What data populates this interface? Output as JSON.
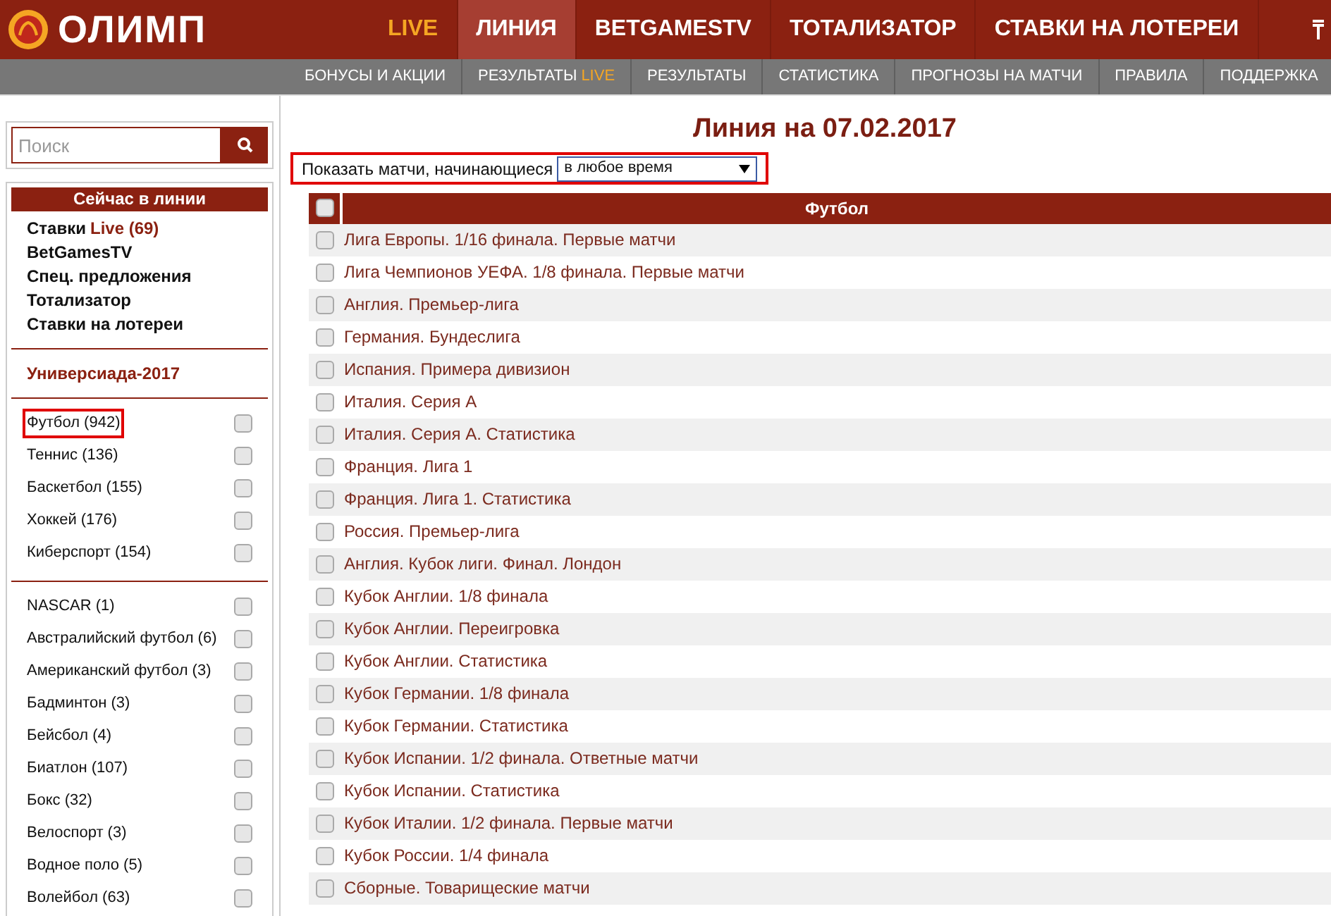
{
  "header": {
    "logo": "ОЛИМП",
    "nav": [
      {
        "label": "LIVE",
        "kind": "live",
        "selected": false
      },
      {
        "label": "ЛИНИЯ",
        "kind": "normal",
        "selected": true
      },
      {
        "label": "BETGAMESTV",
        "kind": "normal",
        "selected": false
      },
      {
        "label": "ТОТАЛИЗАТОР",
        "kind": "normal",
        "selected": false
      },
      {
        "label": "СТАВКИ НА ЛОТЕРЕИ",
        "kind": "normal",
        "selected": false
      }
    ]
  },
  "subnav": [
    {
      "label": "БОНУСЫ И АКЦИИ"
    },
    {
      "label": "РЕЗУЛЬТАТЫ",
      "accent": "LIVE"
    },
    {
      "label": "РЕЗУЛЬТАТЫ"
    },
    {
      "label": "СТАТИСТИКА"
    },
    {
      "label": "ПРОГНОЗЫ НА МАТЧИ"
    },
    {
      "label": "ПРАВИЛА"
    },
    {
      "label": "ПОДДЕРЖКА"
    }
  ],
  "sidebar": {
    "search": {
      "placeholder": "Поиск"
    },
    "title": "Сейчас в линии",
    "links": [
      {
        "label": "Ставки",
        "accent": "Live (69)"
      },
      {
        "label": "BetGamesTV"
      },
      {
        "label": "Спец. предложения"
      },
      {
        "label": "Тотализатор"
      },
      {
        "label": "Ставки на лотереи"
      }
    ],
    "event": "Универсиада-2017",
    "groups": [
      [
        {
          "label": "Футбол (942)",
          "checked": false,
          "highlighted": true
        },
        {
          "label": "Теннис (136)",
          "checked": false,
          "highlighted": false
        },
        {
          "label": "Баскетбол (155)",
          "checked": false,
          "highlighted": false
        },
        {
          "label": "Хоккей (176)",
          "checked": false,
          "highlighted": false
        },
        {
          "label": "Киберспорт (154)",
          "checked": false,
          "highlighted": false
        }
      ],
      [
        {
          "label": "NASCAR (1)",
          "checked": false,
          "highlighted": false
        },
        {
          "label": "Австралийский футбол (6)",
          "checked": false,
          "highlighted": false
        },
        {
          "label": "Американский футбол (3)",
          "checked": false,
          "highlighted": false
        },
        {
          "label": "Бадминтон (3)",
          "checked": false,
          "highlighted": false
        },
        {
          "label": "Бейсбол (4)",
          "checked": false,
          "highlighted": false
        },
        {
          "label": "Биатлон (107)",
          "checked": false,
          "highlighted": false
        },
        {
          "label": "Бокс (32)",
          "checked": false,
          "highlighted": false
        },
        {
          "label": "Велоспорт (3)",
          "checked": false,
          "highlighted": false
        },
        {
          "label": "Водное поло (5)",
          "checked": false,
          "highlighted": false
        },
        {
          "label": "Волейбол (63)",
          "checked": false,
          "highlighted": false
        }
      ]
    ]
  },
  "main": {
    "title": "Линия на 07.02.2017",
    "filter": {
      "label": "Показать матчи, начинающиеся",
      "value": "в любое время",
      "highlighted": true
    },
    "table": {
      "heading": "Футбол",
      "all_checked": false,
      "rows": [
        {
          "label": "Лига Европы. 1/16 финала. Первые матчи",
          "checked": false
        },
        {
          "label": "Лига Чемпионов УЕФА. 1/8 финала. Первые матчи",
          "checked": false
        },
        {
          "label": "Англия. Премьер-лига",
          "checked": false
        },
        {
          "label": "Германия. Бундеслига",
          "checked": false
        },
        {
          "label": "Испания. Примера дивизион",
          "checked": false
        },
        {
          "label": "Италия. Серия А",
          "checked": false
        },
        {
          "label": "Италия. Серия А. Статистика",
          "checked": false
        },
        {
          "label": "Франция. Лига 1",
          "checked": false
        },
        {
          "label": "Франция. Лига 1. Статистика",
          "checked": false
        },
        {
          "label": "Россия. Премьер-лига",
          "checked": false
        },
        {
          "label": "Англия. Кубок лиги. Финал. Лондон",
          "checked": false
        },
        {
          "label": "Кубок Англии. 1/8 финала",
          "checked": false
        },
        {
          "label": "Кубок Англии. Переигровка",
          "checked": false
        },
        {
          "label": "Кубок Англии. Статистика",
          "checked": false
        },
        {
          "label": "Кубок Германии. 1/8 финала",
          "checked": false
        },
        {
          "label": "Кубок Германии. Статистика",
          "checked": false
        },
        {
          "label": "Кубок Испании. 1/2 финала. Ответные матчи",
          "checked": false
        },
        {
          "label": "Кубок Испании. Статистика",
          "checked": false
        },
        {
          "label": "Кубок Италии. 1/2 финала. Первые матчи",
          "checked": false
        },
        {
          "label": "Кубок России. 1/4 финала",
          "checked": false
        },
        {
          "label": "Сборные. Товарищеские матчи",
          "checked": false
        }
      ]
    }
  }
}
